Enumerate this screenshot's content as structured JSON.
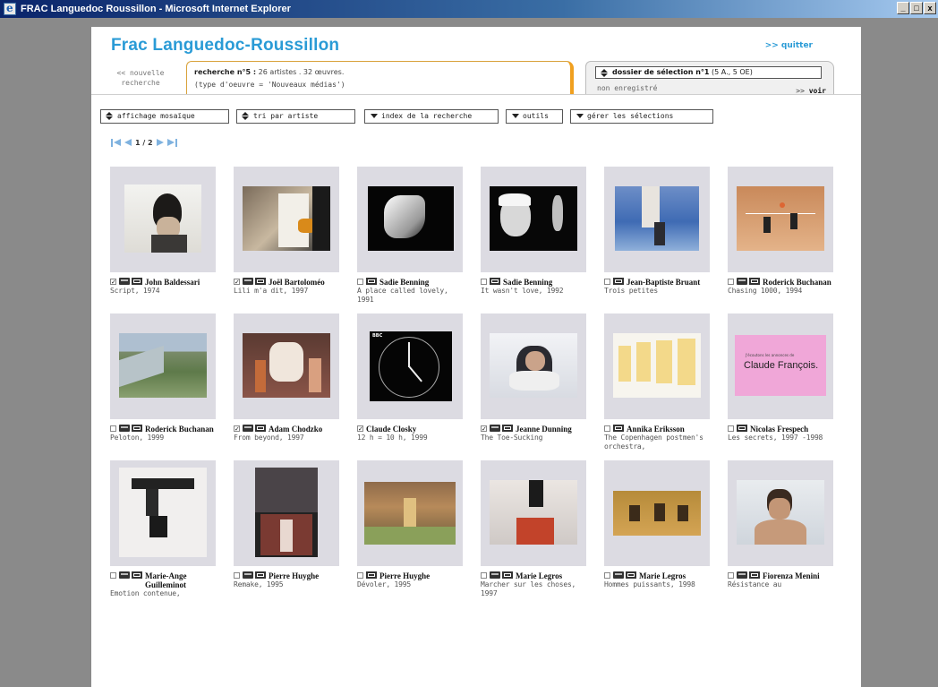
{
  "window": {
    "title": "FRAC Languedoc Roussillon - Microsoft Internet Explorer",
    "controls": [
      "_",
      "□",
      "x"
    ]
  },
  "header": {
    "site_title": "Frac Languedoc-Roussillon",
    "quit_link": ">> quitter",
    "new_search": "<< nouvelle recherche"
  },
  "search_tab": {
    "label": "recherche n°5 :",
    "summary": " 26 artistes . 32 œuvres.",
    "filter": "(type d'oeuvre = 'Nouveaux médias')"
  },
  "selection_tab": {
    "label": "dossier de sélection n°1",
    "counts": " (5 A., 5 OE)",
    "status": "non enregistré",
    "voir_prefix": ">> ",
    "voir": "voir"
  },
  "toolbar": {
    "display": "affichage mosaïque",
    "sort": "tri par artiste",
    "index": "index de la recherche",
    "tools": "outils",
    "manage": "gérer les sélections"
  },
  "pager": {
    "text": "1 / 2"
  },
  "items": [
    {
      "checked": true,
      "artist": "John Baldessari",
      "work": "Script, 1974",
      "badges": 2
    },
    {
      "checked": true,
      "artist": "Joël Bartoloméo",
      "work": "Lili m'a dit, 1997",
      "badges": 2
    },
    {
      "checked": false,
      "artist": "Sadie Benning",
      "work": "A place called lovely, 1991",
      "badges": 1
    },
    {
      "checked": false,
      "artist": "Sadie Benning",
      "work": "It wasn't love, 1992",
      "badges": 1
    },
    {
      "checked": false,
      "artist": "Jean-Baptiste Bruant",
      "work": "Trois petites",
      "badges": 1
    },
    {
      "checked": false,
      "artist": "Roderick Buchanan",
      "work": "Chasing 1000, 1994",
      "badges": 2
    },
    {
      "checked": false,
      "artist": "Roderick Buchanan",
      "work": "Peloton, 1999",
      "badges": 2
    },
    {
      "checked": true,
      "artist": "Adam Chodzko",
      "work": "From beyond, 1997",
      "badges": 2
    },
    {
      "checked": true,
      "artist": "Claude Closky",
      "work": "12 h = 10 h, 1999",
      "badges": 0
    },
    {
      "checked": true,
      "artist": "Jeanne Dunning",
      "work": "The Toe-Sucking",
      "badges": 2
    },
    {
      "checked": false,
      "artist": "Annika Eriksson",
      "work": "The Copenhagen postmen's orchestra,",
      "badges": 1
    },
    {
      "checked": false,
      "artist": "Nicolas Frespech",
      "work": "Les secrets, 1997 -1998",
      "badges": 1
    },
    {
      "checked": false,
      "artist": "Marie-Ange Guilleminot",
      "work": "Emotion contenue,",
      "badges": 2
    },
    {
      "checked": false,
      "artist": "Pierre Huyghe",
      "work": "Remake, 1995",
      "badges": 2
    },
    {
      "checked": false,
      "artist": "Pierre Huyghe",
      "work": "Dévoler, 1995",
      "badges": 1
    },
    {
      "checked": false,
      "artist": "Marie Legros",
      "work": "Marcher sur les choses, 1997",
      "badges": 2
    },
    {
      "checked": false,
      "artist": "Marie Legros",
      "work": "Hommes puissants, 1998",
      "badges": 2
    },
    {
      "checked": false,
      "artist": "Fiorenza Menini",
      "work": "Résistance au",
      "badges": 2
    }
  ],
  "thumb_text": {
    "clock_logo": "BBC",
    "claude_small": "J'écoutons les annonces de",
    "claude_big": "Claude François."
  }
}
